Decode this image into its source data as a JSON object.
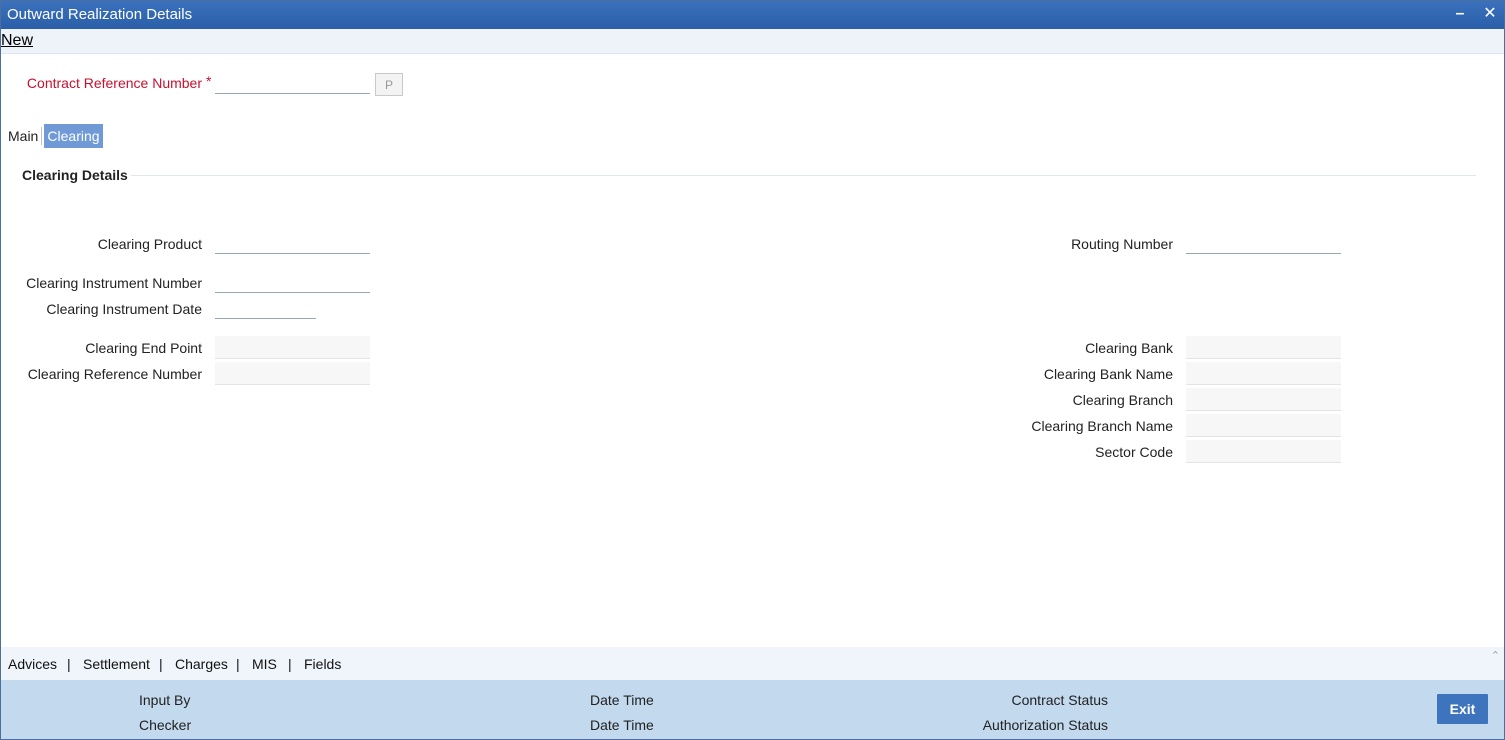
{
  "window": {
    "title": "Outward Realization Details",
    "minimize_icon": "minimize-icon",
    "close_icon": "close-icon"
  },
  "toolbar": {
    "new_label": "New"
  },
  "contract": {
    "label": "Contract Reference Number",
    "required_mark": "*",
    "value": "",
    "p_button": "P"
  },
  "tabs": [
    {
      "label": "Main",
      "active": false
    },
    {
      "label": "Clearing",
      "active": true
    }
  ],
  "section": {
    "title": "Clearing Details"
  },
  "left_fields": {
    "clearing_product": {
      "label": "Clearing Product",
      "value": ""
    },
    "clearing_instrument_number": {
      "label": "Clearing Instrument Number",
      "value": ""
    },
    "clearing_instrument_date": {
      "label": "Clearing Instrument Date",
      "value": ""
    },
    "clearing_end_point": {
      "label": "Clearing End Point",
      "value": ""
    },
    "clearing_reference_number": {
      "label": "Clearing Reference Number",
      "value": ""
    }
  },
  "right_fields": {
    "routing_number": {
      "label": "Routing Number",
      "value": ""
    },
    "clearing_bank": {
      "label": "Clearing Bank",
      "value": ""
    },
    "clearing_bank_name": {
      "label": "Clearing Bank Name",
      "value": ""
    },
    "clearing_branch": {
      "label": "Clearing Branch",
      "value": ""
    },
    "clearing_branch_name": {
      "label": "Clearing Branch Name",
      "value": ""
    },
    "sector_code": {
      "label": "Sector Code",
      "value": ""
    }
  },
  "bottom_links": [
    "Advices",
    "Settlement",
    "Charges",
    "MIS",
    "Fields"
  ],
  "bottom_separator": "|",
  "footer": {
    "input_by": "Input By",
    "checker": "Checker",
    "date_time_1": "Date Time",
    "date_time_2": "Date Time",
    "contract_status": "Contract Status",
    "authorization_status": "Authorization Status",
    "exit": "Exit"
  },
  "colors": {
    "titlebar": "#2f66b3",
    "active_tab": "#6f9ad6",
    "required_label": "#c8102e",
    "footer_bg": "#c2d9ee",
    "exit_button": "#3e74bd"
  }
}
